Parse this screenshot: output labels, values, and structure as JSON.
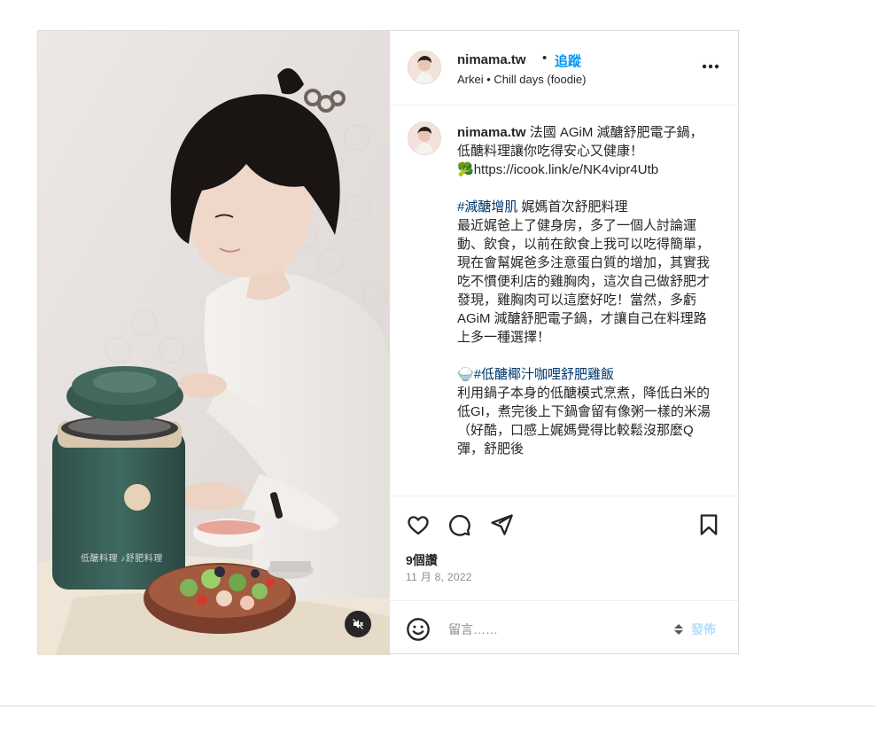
{
  "post": {
    "username": "nimama.tw",
    "follow_label": "追蹤",
    "separator": "•",
    "subtitle": "Arkei • Chill days (foodie)",
    "avatar_icon": "profile-avatar",
    "more_icon": "more-horizontal-icon"
  },
  "media": {
    "overlay_text": "低醣料理 ♪舒肥料理",
    "mute_icon": "volume-muted-icon"
  },
  "caption": {
    "username": "nimama.tw",
    "line1": " 法國 AGiM 減醣舒肥電子鍋，低醣料理讓你吃得安心又健康！",
    "link_emoji": "🥦",
    "link": "https://icook.link/e/NK4vipr4Utb",
    "hashtag1": "#減醣增肌",
    "para1": " 娓媽首次舒肥料理\n最近娓爸上了健身房，多了一個人討論運動、飲食，以前在飲食上我可以吃得簡單，現在會幫娓爸多注意蛋白質的增加，其實我吃不慣便利店的雞胸肉，這次自己做舒肥才發現，雞胸肉可以這麼好吃！當然，多虧AGiM 減醣舒肥電子鍋，才讓自己在料理路上多一種選擇！",
    "emoji2": "🍚",
    "hashtag2": "#低醣椰汁咖哩舒肥雞飯",
    "para2": "\n利用鍋子本身的低醣模式烹煮，降低白米的低GI，煮完後上下鍋會留有像粥一樣的米湯（好酷，口感上娓媽覺得比較鬆沒那麼Q彈，舒肥後"
  },
  "actions": {
    "like_icon": "heart-icon",
    "comment_icon": "comment-icon",
    "share_icon": "paper-plane-icon",
    "save_icon": "bookmark-icon",
    "likes": "9個讚",
    "date": "11 月 8, 2022"
  },
  "comment": {
    "emoji_icon": "smiley-icon",
    "placeholder": "留言……",
    "post_label": "發佈"
  },
  "colors": {
    "accent": "#0095f6",
    "hashtag": "#00376b",
    "post_disabled": "#b2dffc",
    "muted_text": "#8e8e8e",
    "border": "#dbdbdb"
  }
}
